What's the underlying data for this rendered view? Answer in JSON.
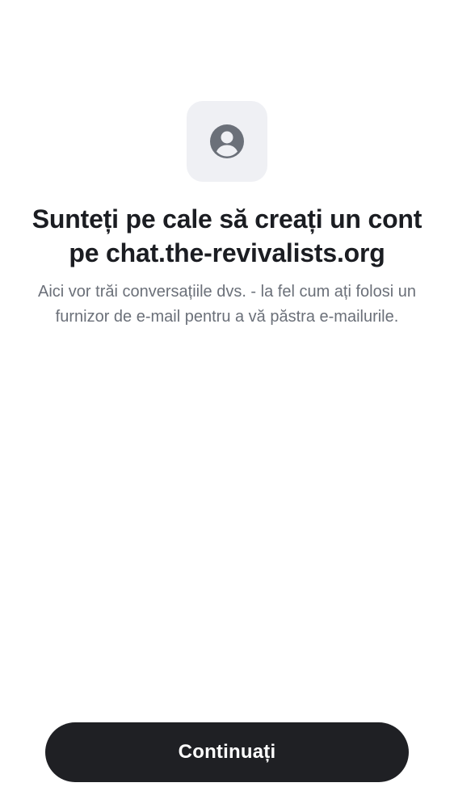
{
  "header": {
    "icon": "user-account-icon",
    "title": "Sunteți pe cale să creați un cont pe chat.the-revivalists.org",
    "subtitle": "Aici vor trăi conversațiile dvs. - la fel cum ați folosi un furnizor de e-mail pentru a vă păstra e-mailurile."
  },
  "actions": {
    "continue_label": "Continuați"
  },
  "colors": {
    "background": "#ffffff",
    "icon_tile": "#eff0f4",
    "icon": "#6b7079",
    "title": "#1b1d22",
    "subtitle": "#6b7079",
    "button_bg": "#1f2024",
    "button_text": "#ffffff"
  }
}
